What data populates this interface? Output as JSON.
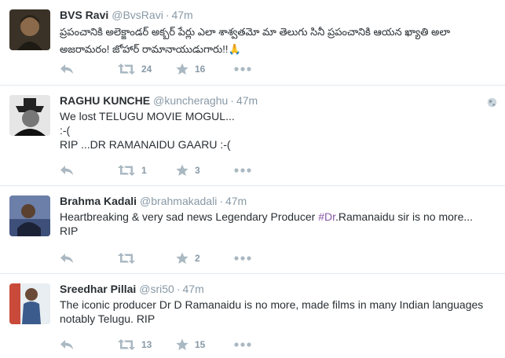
{
  "tweets": [
    {
      "fullname": "BVS Ravi",
      "username": "@BvsRavi",
      "separator": "·",
      "time": "47m",
      "text": "ప్రపంచానికి అలెక్జాండర్ అక్బర్ పేర్లు ఎలా శాశ్వతమో మా తెలుగు సినీ ప్రపంచానికి ఆయన ఖ్యాతి అలా అజరామరం! జోహార్ రామానాయుడుగారు!!🙏",
      "retweets": "24",
      "favorites": "16",
      "avatar_icon": "person-portrait-icon"
    },
    {
      "fullname": "RAGHU KUNCHE",
      "username": "@kuncheraghu",
      "separator": "·",
      "time": "47m",
      "text": "We lost TELUGU MOVIE MOGUL...\n:-(\nRIP ...DR RAMANAIDU GAARU :-(",
      "retweets": "1",
      "favorites": "3",
      "avatar_icon": "person-portrait-icon",
      "globe_icon": "globe-icon"
    },
    {
      "fullname": "Brahma Kadali",
      "username": "@brahmakadali",
      "separator": "·",
      "time": "47m",
      "text_before": "Heartbreaking & very sad news Legendary Producer ",
      "hashtag": "#Dr",
      "text_after": ".Ramanaidu sir is no more... RIP",
      "retweets": "",
      "favorites": "2",
      "avatar_icon": "person-portrait-icon"
    },
    {
      "fullname": "Sreedhar Pillai",
      "username": "@sri50",
      "separator": "·",
      "time": "47m",
      "text": "The iconic producer Dr D Ramanaidu is no more, made films in many Indian languages notably Telugu. RIP",
      "retweets": "13",
      "favorites": "15",
      "avatar_icon": "person-portrait-icon"
    }
  ],
  "colors": {
    "text": "#292f33",
    "muted": "#8899a6",
    "icon": "#aab8c2",
    "hashtag": "#8856a7",
    "border": "#e1e8ed"
  }
}
